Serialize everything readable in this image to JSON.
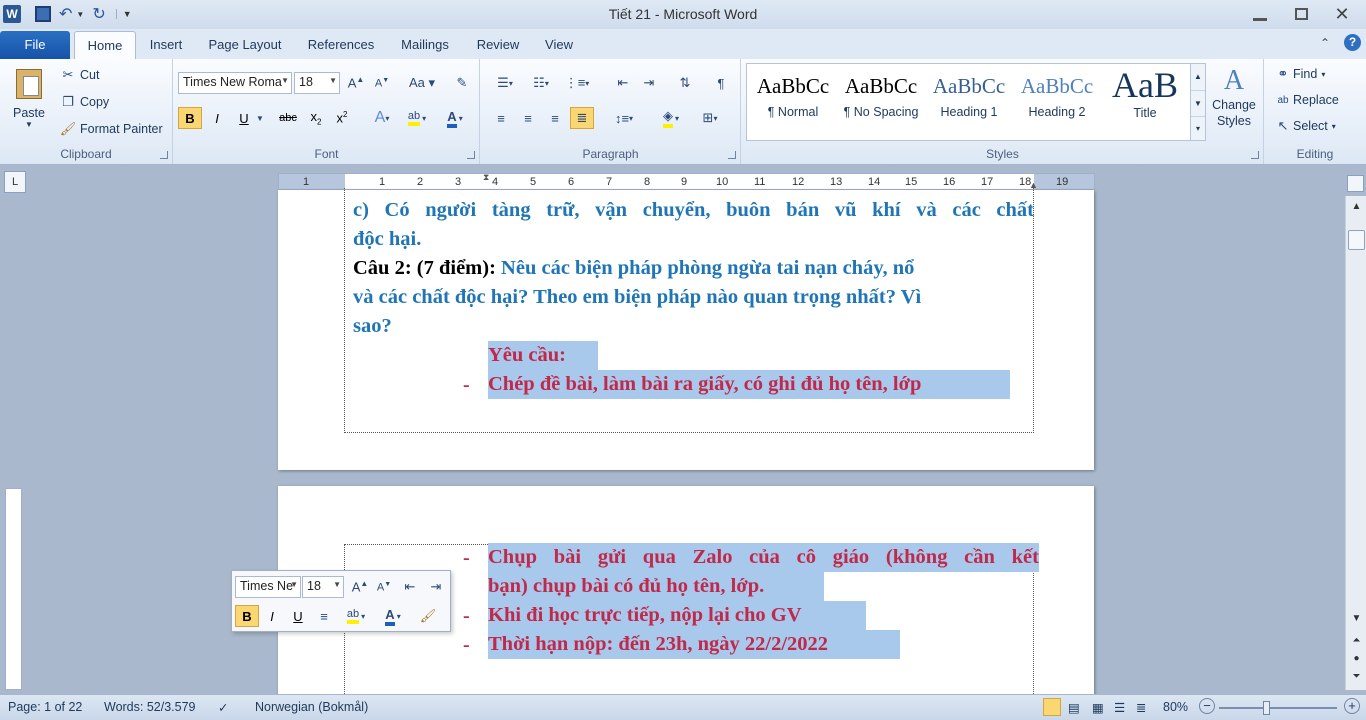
{
  "window": {
    "title": "Tiết 21  -  Microsoft Word",
    "minimize_icon": "minimize-icon",
    "restore_icon": "restore-icon",
    "close_icon": "close-icon"
  },
  "tabs": [
    "File",
    "Home",
    "Insert",
    "Page Layout",
    "References",
    "Mailings",
    "Review",
    "View"
  ],
  "ribbon": {
    "clipboard": {
      "paste": "Paste",
      "cut": "Cut",
      "copy": "Copy",
      "format_painter": "Format Painter",
      "label": "Clipboard"
    },
    "font": {
      "font_name": "Times New Roma",
      "font_size": "18",
      "label": "Font"
    },
    "paragraph": {
      "label": "Paragraph"
    },
    "styles": {
      "items": [
        {
          "sample": "AaBbCc",
          "name": "¶ Normal"
        },
        {
          "sample": "AaBbCc",
          "name": "¶ No Spacing"
        },
        {
          "sample": "AaBbCc",
          "name": "Heading 1"
        },
        {
          "sample": "AaBbCc",
          "name": "Heading 2"
        },
        {
          "sample": "AaB",
          "name": "Title"
        }
      ],
      "change_styles": "Change Styles",
      "label": "Styles"
    },
    "editing": {
      "find": "Find",
      "replace": "Replace",
      "select": "Select",
      "label": "Editing"
    }
  },
  "ruler": {
    "ticks": [
      "1",
      "1",
      "2",
      "3",
      "4",
      "5",
      "6",
      "7",
      "8",
      "9",
      "10",
      "11",
      "12",
      "13",
      "14",
      "15",
      "16",
      "17",
      "18",
      "19"
    ]
  },
  "document": {
    "page1": {
      "line1": "c)   Có người tàng trữ, vận chuyển, buôn bán vũ khí và các chất",
      "line2": "độc hại.",
      "q2_label": "Câu 2: (7 điểm):",
      "line3_rest": "Nêu các biện pháp phòng ngừa tai nạn cháy, nổ",
      "line4": "và các chất độc hại? Theo em biện pháp nào quan trọng nhất? Vì",
      "line5": "sao?",
      "req_title": "Yêu cầu:",
      "req1": "Chép đề bài, làm bài ra giấy, có ghi đủ họ tên, lớp"
    },
    "page2": {
      "req2_a": "Chụp bài gửi qua Zalo của cô giáo (không cần kết",
      "req2_b": "bạn) chụp bài có đủ họ tên, lớp.",
      "req3": "Khi đi học trực tiếp, nộp lại cho GV",
      "req4": "Thời hạn nộp: đến 23h, ngày 22/2/2022"
    },
    "bullet": "-"
  },
  "mini_toolbar": {
    "font_name": "Times Ne",
    "font_size": "18"
  },
  "status": {
    "page": "Page: 1 of 22",
    "words": "Words: 52/3.579",
    "language": "Norwegian (Bokmål)",
    "zoom": "80%"
  },
  "colors": {
    "blue_text": "#1f75b5",
    "red_text": "#c0294a",
    "selection": "#a8c8ec",
    "file_tab": "#1653a7"
  }
}
